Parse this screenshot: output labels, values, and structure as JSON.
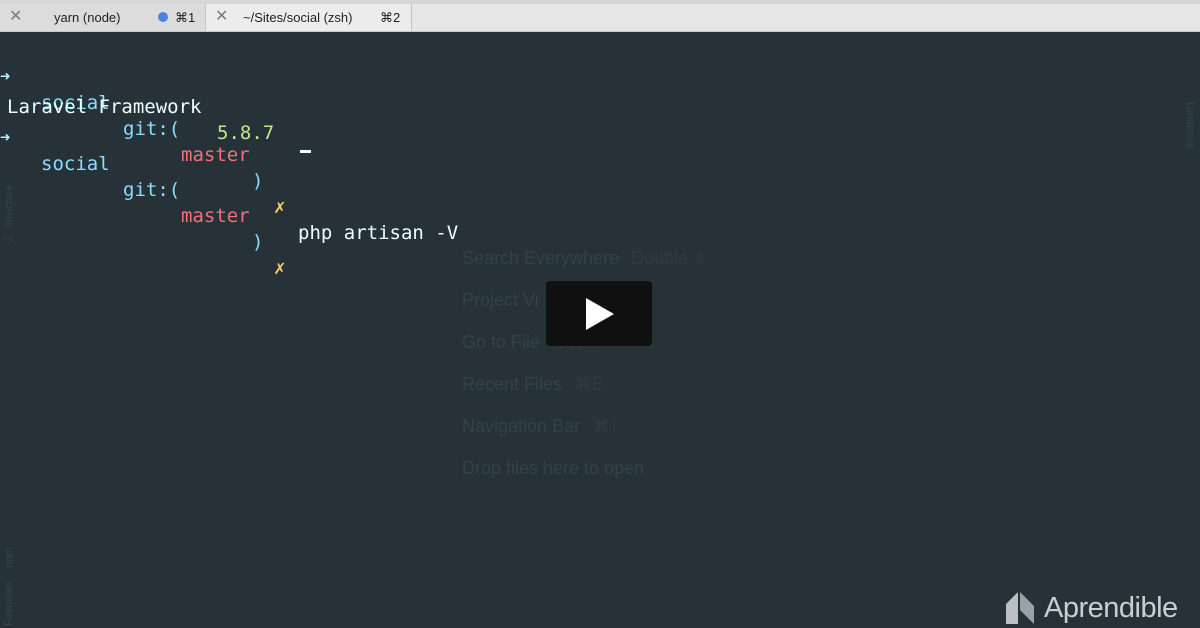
{
  "tabs": [
    {
      "title": "yarn (node)",
      "shortcut": "⌘1",
      "close": "✕",
      "active": false
    },
    {
      "title": "~/Sites/social (zsh)",
      "shortcut": "⌘2",
      "close": "✕",
      "active": true
    }
  ],
  "terminal": {
    "line1": {
      "prompt_arrow": "➜",
      "dir": "social",
      "git_label": "git:(",
      "branch": "master",
      "git_close": ")",
      "dirty": "✗",
      "command": "php artisan -V"
    },
    "line2": {
      "text": "Laravel Framework ",
      "version": "5.8.7"
    },
    "line3": {
      "prompt_arrow": "➜",
      "dir": "social",
      "git_label": "git:(",
      "branch": "master",
      "git_close": ")",
      "dirty": "✗"
    }
  },
  "welcome_hints": [
    {
      "label": "Search Everywhere",
      "shortcut": "Double ⇧"
    },
    {
      "label": "Project Vi",
      "shortcut": ""
    },
    {
      "label": "Go to File",
      "shortcut": "⇧⌘O"
    },
    {
      "label": "Recent Files",
      "shortcut": "⌘E"
    },
    {
      "label": "Navigation Bar",
      "shortcut": "⌘↑"
    },
    {
      "label": "Drop files here to open",
      "shortcut": ""
    }
  ],
  "side_panels": {
    "left_structure": "Z: Structure",
    "left_npm": "npm",
    "left_favorites": "Favorites",
    "right_database": "Database"
  },
  "player": {
    "button": "play-button"
  },
  "brand": {
    "name": "Aprendible"
  },
  "colors": {
    "background": "#263238",
    "cyan": "#89ddff",
    "branch": "#f07178",
    "dirty": "#ffcb6b",
    "version": "#c3e88d"
  }
}
